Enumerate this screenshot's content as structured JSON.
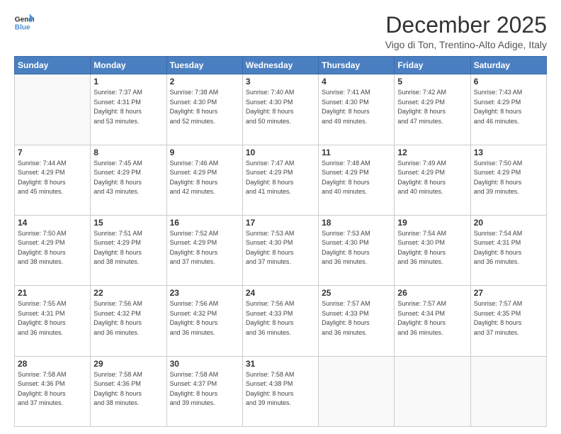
{
  "logo": {
    "line1": "General",
    "line2": "Blue"
  },
  "title": "December 2025",
  "subtitle": "Vigo di Ton, Trentino-Alto Adige, Italy",
  "days_header": [
    "Sunday",
    "Monday",
    "Tuesday",
    "Wednesday",
    "Thursday",
    "Friday",
    "Saturday"
  ],
  "weeks": [
    [
      {
        "day": "",
        "info": ""
      },
      {
        "day": "1",
        "info": "Sunrise: 7:37 AM\nSunset: 4:31 PM\nDaylight: 8 hours\nand 53 minutes."
      },
      {
        "day": "2",
        "info": "Sunrise: 7:38 AM\nSunset: 4:30 PM\nDaylight: 8 hours\nand 52 minutes."
      },
      {
        "day": "3",
        "info": "Sunrise: 7:40 AM\nSunset: 4:30 PM\nDaylight: 8 hours\nand 50 minutes."
      },
      {
        "day": "4",
        "info": "Sunrise: 7:41 AM\nSunset: 4:30 PM\nDaylight: 8 hours\nand 49 minutes."
      },
      {
        "day": "5",
        "info": "Sunrise: 7:42 AM\nSunset: 4:29 PM\nDaylight: 8 hours\nand 47 minutes."
      },
      {
        "day": "6",
        "info": "Sunrise: 7:43 AM\nSunset: 4:29 PM\nDaylight: 8 hours\nand 46 minutes."
      }
    ],
    [
      {
        "day": "7",
        "info": "Sunrise: 7:44 AM\nSunset: 4:29 PM\nDaylight: 8 hours\nand 45 minutes."
      },
      {
        "day": "8",
        "info": "Sunrise: 7:45 AM\nSunset: 4:29 PM\nDaylight: 8 hours\nand 43 minutes."
      },
      {
        "day": "9",
        "info": "Sunrise: 7:46 AM\nSunset: 4:29 PM\nDaylight: 8 hours\nand 42 minutes."
      },
      {
        "day": "10",
        "info": "Sunrise: 7:47 AM\nSunset: 4:29 PM\nDaylight: 8 hours\nand 41 minutes."
      },
      {
        "day": "11",
        "info": "Sunrise: 7:48 AM\nSunset: 4:29 PM\nDaylight: 8 hours\nand 40 minutes."
      },
      {
        "day": "12",
        "info": "Sunrise: 7:49 AM\nSunset: 4:29 PM\nDaylight: 8 hours\nand 40 minutes."
      },
      {
        "day": "13",
        "info": "Sunrise: 7:50 AM\nSunset: 4:29 PM\nDaylight: 8 hours\nand 39 minutes."
      }
    ],
    [
      {
        "day": "14",
        "info": "Sunrise: 7:50 AM\nSunset: 4:29 PM\nDaylight: 8 hours\nand 38 minutes."
      },
      {
        "day": "15",
        "info": "Sunrise: 7:51 AM\nSunset: 4:29 PM\nDaylight: 8 hours\nand 38 minutes."
      },
      {
        "day": "16",
        "info": "Sunrise: 7:52 AM\nSunset: 4:29 PM\nDaylight: 8 hours\nand 37 minutes."
      },
      {
        "day": "17",
        "info": "Sunrise: 7:53 AM\nSunset: 4:30 PM\nDaylight: 8 hours\nand 37 minutes."
      },
      {
        "day": "18",
        "info": "Sunrise: 7:53 AM\nSunset: 4:30 PM\nDaylight: 8 hours\nand 36 minutes."
      },
      {
        "day": "19",
        "info": "Sunrise: 7:54 AM\nSunset: 4:30 PM\nDaylight: 8 hours\nand 36 minutes."
      },
      {
        "day": "20",
        "info": "Sunrise: 7:54 AM\nSunset: 4:31 PM\nDaylight: 8 hours\nand 36 minutes."
      }
    ],
    [
      {
        "day": "21",
        "info": "Sunrise: 7:55 AM\nSunset: 4:31 PM\nDaylight: 8 hours\nand 36 minutes."
      },
      {
        "day": "22",
        "info": "Sunrise: 7:56 AM\nSunset: 4:32 PM\nDaylight: 8 hours\nand 36 minutes."
      },
      {
        "day": "23",
        "info": "Sunrise: 7:56 AM\nSunset: 4:32 PM\nDaylight: 8 hours\nand 36 minutes."
      },
      {
        "day": "24",
        "info": "Sunrise: 7:56 AM\nSunset: 4:33 PM\nDaylight: 8 hours\nand 36 minutes."
      },
      {
        "day": "25",
        "info": "Sunrise: 7:57 AM\nSunset: 4:33 PM\nDaylight: 8 hours\nand 36 minutes."
      },
      {
        "day": "26",
        "info": "Sunrise: 7:57 AM\nSunset: 4:34 PM\nDaylight: 8 hours\nand 36 minutes."
      },
      {
        "day": "27",
        "info": "Sunrise: 7:57 AM\nSunset: 4:35 PM\nDaylight: 8 hours\nand 37 minutes."
      }
    ],
    [
      {
        "day": "28",
        "info": "Sunrise: 7:58 AM\nSunset: 4:36 PM\nDaylight: 8 hours\nand 37 minutes."
      },
      {
        "day": "29",
        "info": "Sunrise: 7:58 AM\nSunset: 4:36 PM\nDaylight: 8 hours\nand 38 minutes."
      },
      {
        "day": "30",
        "info": "Sunrise: 7:58 AM\nSunset: 4:37 PM\nDaylight: 8 hours\nand 39 minutes."
      },
      {
        "day": "31",
        "info": "Sunrise: 7:58 AM\nSunset: 4:38 PM\nDaylight: 8 hours\nand 39 minutes."
      },
      {
        "day": "",
        "info": ""
      },
      {
        "day": "",
        "info": ""
      },
      {
        "day": "",
        "info": ""
      }
    ]
  ]
}
